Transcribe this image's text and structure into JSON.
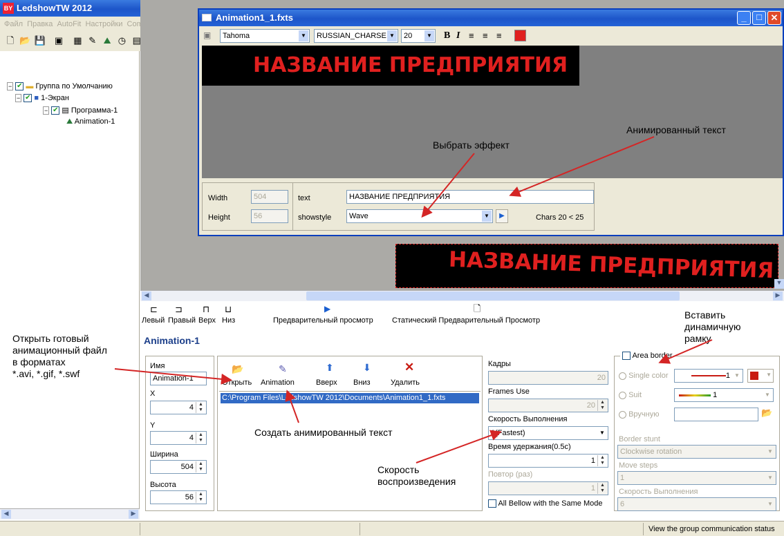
{
  "app": {
    "title": "LedshowTW 2012",
    "menu": [
      "Файл",
      "Правка",
      "AutoFit",
      "Настройки",
      "Common"
    ]
  },
  "tree": {
    "items": [
      {
        "label": "Группа по Умолчанию"
      },
      {
        "label": "1-Экран"
      },
      {
        "label": "Программа-1"
      },
      {
        "label": "Animation-1"
      }
    ]
  },
  "editor": {
    "title": "Animation1_1.fxts",
    "font": "Tahoma",
    "charset": "RUSSIAN_CHARSE",
    "size": "20",
    "preview_text": "НАЗВАНИЕ ПРЕДПРИЯТИЯ",
    "width_label": "Width",
    "width_value": "504",
    "height_label": "Height",
    "height_value": "56",
    "text_label": "text",
    "text_value": "НАЗВАНИЕ ПРЕДПРИЯТИЯ",
    "showstyle_label": "showstyle",
    "showstyle_value": "Wave",
    "chars_info": "Chars 20  < 25"
  },
  "canvas": {
    "wave_text": "НАЗВАНИЕ ПРЕДПРИЯТИЯ"
  },
  "toolbar2": {
    "left": "Левый",
    "right": "Правый",
    "top": "Верх",
    "bottom": "Низ",
    "preview": "Предварительный просмотр",
    "static_preview": "Статический Предварительный Просмотр"
  },
  "props": {
    "section_title": "Animation-1",
    "name_label": "Имя",
    "name_value": "Animation-1",
    "x_label": "X",
    "x_value": "4",
    "y_label": "Y",
    "y_value": "4",
    "width_label": "Ширина",
    "width_value": "504",
    "height_label": "Высота",
    "height_value": "56"
  },
  "files": {
    "open": "Открыть",
    "animation": "Animation",
    "up": "Вверх",
    "down": "Вниз",
    "delete": "Удалить",
    "path": "C:\\Program Files\\LedshowTW 2012\\Documents\\Animation1_1.fxts"
  },
  "frames": {
    "frames_label": "Кадры",
    "frames_value": "20",
    "frames_use_label": "Frames Use",
    "frames_use_value": "20",
    "speed_label": "Скорость Выполнения",
    "speed_value": "1(Fastest)",
    "hold_label": "Время удержания(0.5с)",
    "hold_value": "1",
    "repeat_label": "Повтор (раз)",
    "repeat_value": "1",
    "all_same_label": "All Bellow with the Same Mode"
  },
  "border": {
    "area_border": "Area border",
    "single_color": "Single color",
    "single_value": "1",
    "suit": "Suit",
    "suit_value": "1",
    "manual": "Вручную",
    "border_stunt": "Border stunt",
    "stunt_value": "Clockwise rotation",
    "move_steps": "Move steps",
    "move_value": "1",
    "speed_label": "Скорость Выполнения",
    "speed_value": "6"
  },
  "status": {
    "text": "View the group communication status"
  },
  "annotations": {
    "animated_text": "Анимированный текст",
    "choose_effect": "Выбрать эффект",
    "insert_frame": "Вставить\nдинамичную\nрамку",
    "open_file": "Открыть готовый\nанимационный файл\nв форматах\n*.avi, *.gif, *.swf",
    "create_text": "Создать анимированный текст",
    "playback_speed": "Скорость\nвоспроизведения"
  },
  "colors": {
    "led_red": "#e0201f",
    "title_blue": "#2462d6",
    "panel": "#ece9d8"
  }
}
